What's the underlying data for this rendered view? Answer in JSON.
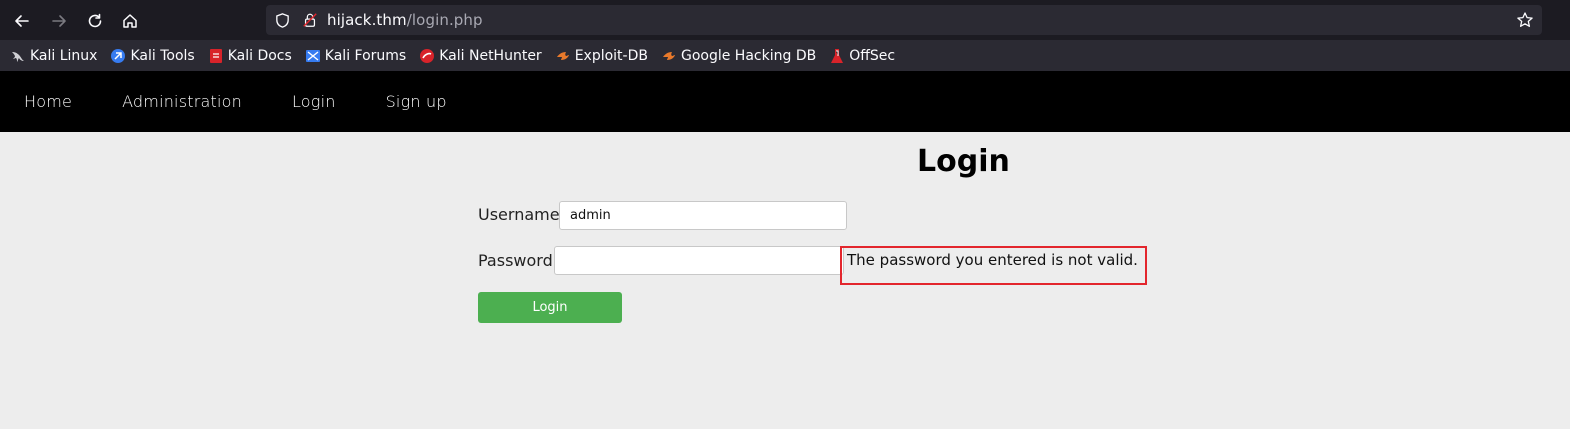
{
  "browser": {
    "url_host": "hijack.thm",
    "url_path": "/login.php",
    "bookmarks": [
      {
        "label": "Kali Linux",
        "icon": "kali-dragon-icon"
      },
      {
        "label": "Kali Tools",
        "icon": "kali-tools-icon"
      },
      {
        "label": "Kali Docs",
        "icon": "kali-docs-icon"
      },
      {
        "label": "Kali Forums",
        "icon": "kali-forums-icon"
      },
      {
        "label": "Kali NetHunter",
        "icon": "kali-nethunter-icon"
      },
      {
        "label": "Exploit-DB",
        "icon": "exploit-db-icon"
      },
      {
        "label": "Google Hacking DB",
        "icon": "ghdb-icon"
      },
      {
        "label": "OffSec",
        "icon": "offsec-icon"
      }
    ]
  },
  "nav": {
    "home": "Home",
    "administration": "Administration",
    "login": "Login",
    "signup": "Sign up"
  },
  "form": {
    "title": "Login",
    "username_label": "Username",
    "username_value": "admin",
    "password_label": "Password",
    "password_value": "",
    "error": "The password you entered is not valid.",
    "submit_label": "Login"
  },
  "colors": {
    "submit_button": "#4caf50",
    "error_border": "#e3262d",
    "navbar": "#000000"
  }
}
